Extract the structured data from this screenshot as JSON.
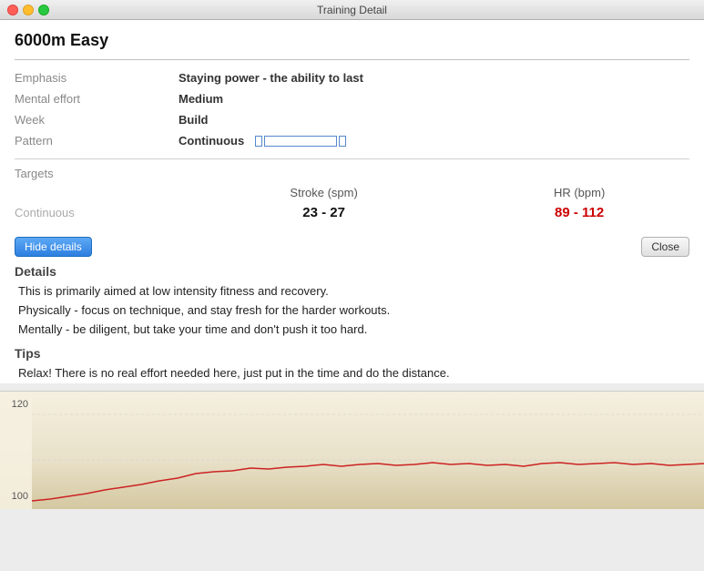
{
  "window": {
    "title": "Training Detail"
  },
  "header": {
    "title": "6000m Easy"
  },
  "info": {
    "emphasis_label": "Emphasis",
    "emphasis_value": "Staying power - the ability to last",
    "mental_effort_label": "Mental effort",
    "mental_effort_value": "Medium",
    "week_label": "Week",
    "week_value": "Build",
    "pattern_label": "Pattern",
    "pattern_value": "Continuous"
  },
  "targets": {
    "section_title": "Targets",
    "stroke_col": "Stroke (spm)",
    "hr_col": "HR (bpm)",
    "row_label": "Continuous",
    "stroke_range": "23 - 27",
    "hr_range": "89 - 112"
  },
  "buttons": {
    "hide_details": "Hide details",
    "close": "Close"
  },
  "details": {
    "section_title": "Details",
    "text_line1": "This is primarily aimed at low intensity fitness and recovery.",
    "text_line2": "Physically - focus on technique, and stay fresh for the harder workouts.",
    "text_line3": "Mentally - be diligent, but take your time and don't push it too hard."
  },
  "tips": {
    "section_title": "Tips",
    "text": "Relax!  There is no real effort needed here, just put in the time and do the distance."
  },
  "chart": {
    "y_labels": [
      "120",
      "100"
    ]
  }
}
